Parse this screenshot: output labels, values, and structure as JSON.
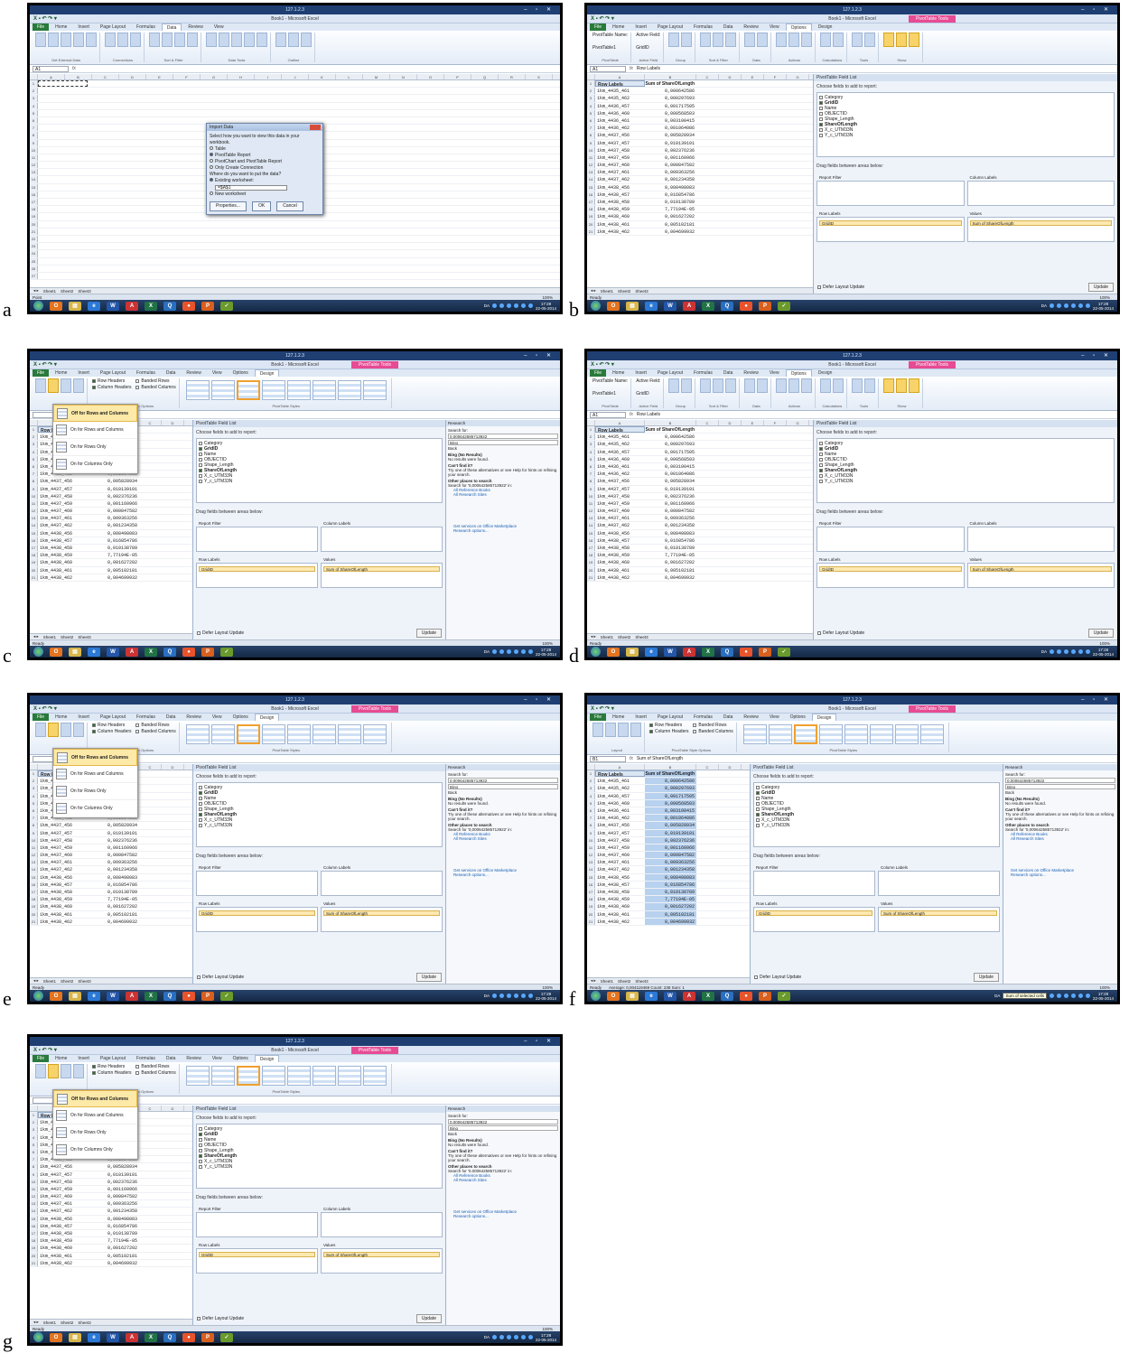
{
  "panel_labels": [
    "a",
    "b",
    "c",
    "d",
    "e",
    "f",
    "g"
  ],
  "window": {
    "remote_title": "127.1.2.3",
    "app_title": "Book1 - Microsoft Excel",
    "pivot_context": "PivotTable Tools"
  },
  "tabs": {
    "base": [
      "File",
      "Home",
      "Insert",
      "Page Layout",
      "Formulas",
      "Data",
      "Review",
      "View"
    ],
    "pivot_extra": [
      "Options",
      "Design"
    ]
  },
  "ribbon": {
    "data_groups": [
      "Get External Data",
      "Connections",
      "Sort & Filter",
      "Data Tools",
      "Outline"
    ],
    "options_groups": [
      "PivotTable",
      "Active Field",
      "Group",
      "Sort & Filter",
      "Data",
      "Actions",
      "Calculations",
      "Tools",
      "Show"
    ],
    "design_groups": [
      "Layout",
      "PivotTable Style Options",
      "PivotTable Styles"
    ],
    "pivottable_name_label": "PivotTable Name:",
    "pivottable_name": "PivotTable1",
    "active_field_label": "Active Field:",
    "active_field": "GridID",
    "style_options": [
      "Row Headers",
      "Banded Rows",
      "Column Headers",
      "Banded Columns"
    ],
    "layout_buttons": [
      "Subtotals",
      "Grand Totals",
      "Report Layout",
      "Blank Rows"
    ]
  },
  "formula_bars": {
    "a": {
      "name": "A1",
      "value": ""
    },
    "b": {
      "name": "A1",
      "value": "Row Labels"
    },
    "c": {
      "name": "",
      "value": "0,000642585713922"
    },
    "d": {
      "name": "A1",
      "value": "Row Labels"
    },
    "e": {
      "name": "",
      "value": "0,000642585713922"
    },
    "f": {
      "name": "B1",
      "value": "Sum of ShareOfLength"
    },
    "g": {
      "name": "",
      "value": "0,000642585713922"
    }
  },
  "grid": {
    "col_letters": [
      "A",
      "B",
      "C",
      "D",
      "E",
      "F",
      "G",
      "H",
      "I",
      "J",
      "K",
      "L",
      "M",
      "N",
      "O",
      "P",
      "Q",
      "R",
      "S"
    ],
    "header": {
      "a": "Row Labels",
      "b": "Sum of ShareOfLength"
    },
    "rows": [
      {
        "a": "1km_4435_461",
        "b": "0,000642586"
      },
      {
        "a": "1km_4435_462",
        "b": "0,000297693"
      },
      {
        "a": "1km_4436_457",
        "b": "0,001717505"
      },
      {
        "a": "1km_4436_460",
        "b": "0,000568503"
      },
      {
        "a": "1km_4436_461",
        "b": "0,003100415"
      },
      {
        "a": "1km_4436_462",
        "b": "0,001064086"
      },
      {
        "a": "1km_4437_456",
        "b": "0,005828934"
      },
      {
        "a": "1km_4437_457",
        "b": "0,010139101"
      },
      {
        "a": "1km_4437_458",
        "b": "0,002376236"
      },
      {
        "a": "1km_4437_459",
        "b": "0,001160966"
      },
      {
        "a": "1km_4437_460",
        "b": "0,000847582"
      },
      {
        "a": "1km_4437_461",
        "b": "0,009363256"
      },
      {
        "a": "1km_4437_462",
        "b": "0,001234358"
      },
      {
        "a": "1km_4438_456",
        "b": "0,008498083"
      },
      {
        "a": "1km_4438_457",
        "b": "0,016854786"
      },
      {
        "a": "1km_4438_458",
        "b": "0,010138789"
      },
      {
        "a": "1km_4438_459",
        "b": "7,77194E-05"
      },
      {
        "a": "1km_4438_460",
        "b": "0,001627202"
      },
      {
        "a": "1km_4438_461",
        "b": "0,005102181"
      },
      {
        "a": "1km_4438_462",
        "b": "0,004699932"
      }
    ],
    "sheet_tabs": [
      "Sheet1",
      "Sheet2",
      "Sheet3"
    ]
  },
  "import_dialog": {
    "title": "Import Data",
    "prompt": "Select how you want to view this data in your workbook.",
    "options": [
      "Table",
      "PivotTable Report",
      "PivotChart and PivotTable Report",
      "Only Create Connection"
    ],
    "where": "Where do you want to put the data?",
    "existing": "Existing worksheet:",
    "ref": "=$A$1",
    "new": "New worksheet",
    "properties": "Properties...",
    "ok": "OK",
    "cancel": "Cancel"
  },
  "field_list": {
    "title": "PivotTable Field List",
    "choose": "Choose fields to add to report:",
    "fields": [
      {
        "name": "Category",
        "checked": false
      },
      {
        "name": "GridID",
        "checked": true
      },
      {
        "name": "Name",
        "checked": false
      },
      {
        "name": "OBJECTID",
        "checked": false
      },
      {
        "name": "Shape_Length",
        "checked": false
      },
      {
        "name": "ShareOfLength",
        "checked": true
      },
      {
        "name": "X_c_UTM33N",
        "checked": false
      },
      {
        "name": "Y_c_UTM33N",
        "checked": false
      }
    ],
    "drag": "Drag fields between areas below:",
    "report_filter": "Report Filter",
    "column_labels": "Column Labels",
    "row_labels": "Row Labels",
    "values": "Values",
    "row_item": "GridID",
    "value_item": "Sum of ShareOfLength",
    "defer": "Defer Layout Update",
    "update": "Update"
  },
  "research": {
    "title": "Research",
    "search_for": "Search for:",
    "query": "0,000642585713922",
    "source": "Bing",
    "back": "Back",
    "bing_result": "Bing (No Results)",
    "no_results": "No results were found.",
    "cant_find": "Can't find it?",
    "try_text": "Try one of these alternatives or see Help for hints on refining your search.",
    "other": "Other places to search",
    "search_for_q": "Search for '0,000642585713922' in:",
    "links": [
      "All Reference Books",
      "All Research Sites"
    ],
    "services": "Get services on Office Marketplace",
    "options": "Research options..."
  },
  "grand_totals_menu": [
    "Off for Rows and Columns",
    "On for Rows and Columns",
    "On for Rows Only",
    "On for Columns Only"
  ],
  "status": {
    "ready": "Ready",
    "point": "Point",
    "f_summary": "Average: 0,004119469   Count: 238   Sum: 1",
    "zoom": "100%",
    "tooltip_f": "Sum of selected cells"
  },
  "taskbar": {
    "time": "17:28",
    "date": "22-05-2014",
    "lang": "DA"
  },
  "colors": {
    "excel_green": "#2a7a3b",
    "pivot_pink": "#e64b93",
    "selection_blue": "#b7d1ef",
    "highlight": "#fde9a8"
  }
}
